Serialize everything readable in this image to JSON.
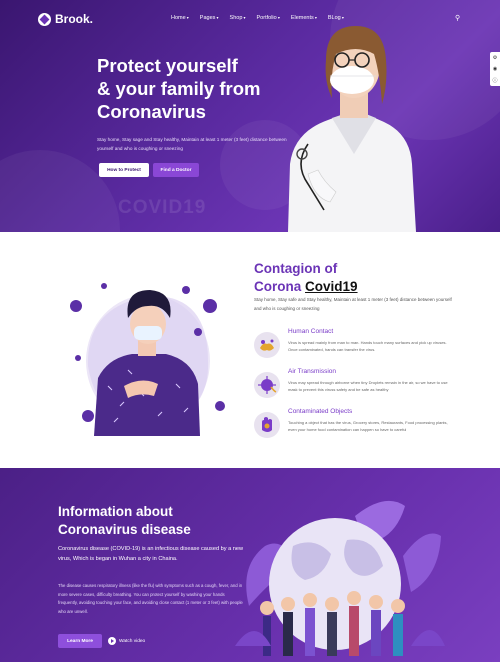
{
  "brand": {
    "name": "Brook."
  },
  "nav": {
    "items": [
      {
        "label": "Home"
      },
      {
        "label": "Pages"
      },
      {
        "label": "Shop"
      },
      {
        "label": "Portfolio"
      },
      {
        "label": "Elements"
      },
      {
        "label": "BLog"
      }
    ]
  },
  "hero": {
    "title_line1": "Protect yourself",
    "title_line2": "& your family from",
    "title_line3": "Coronavirus",
    "description": "Stay home, Stay sage and Stay healthy, Maintain at least 1 meter (3 feet) distance between yourself and who is coughing or sneezing",
    "primary_button": "How to Protect",
    "secondary_button": "Find a Doctor",
    "watermark": "COVID19"
  },
  "contagion": {
    "title_line1": "Contagion of",
    "title_part1": "Corona ",
    "title_highlight": "Covid19",
    "description": "Stay home, Stay safe and Stay healthy, Maintain at least 1 meter (3 feet) distance between yourself and who is coughing or sneezing",
    "features": [
      {
        "icon": "hands-icon",
        "title": "Human Contact",
        "text": "Virus is spread mainly from man to man. Hands touch many surfaces and pick up viruses. Once contaminated, hands can transfer the virus."
      },
      {
        "icon": "virus-icon",
        "title": "Air Transmission",
        "text": "Virus may spread through airborne when tiny Droplets remain in the air, so we have to use mask to prevent this viruss safety and be safe as healthy"
      },
      {
        "icon": "hand-icon",
        "title": "Contaminated Objects",
        "text": "Touching a object that has the virus, Grocery stores, Restaurants, Food processing plants, even your home food contamination can happen so have to careful"
      }
    ]
  },
  "info": {
    "title_line1": "Information about",
    "title_line2": "Coronavirus disease",
    "lead": "Coronavirus disease (COVID-19) is an infectious disease caused by a new virus, Which is began in Wuhan a city in Chaina.",
    "body": "The disease causes respiratory illness (like the flu) with symptoms such as a cough, fever, and in more severe cases, difficulty breathing. You can protect yourself by washing your hands frequently, avoiding touching your face, and avoiding close contact (1 meter or 3 feet) with people who are unwell.",
    "learn_button": "Learn More",
    "watch_label": "Watch video"
  },
  "colors": {
    "primary": "#6b34b6",
    "accent": "#8a47d6",
    "hero_dark": "#3a1670"
  }
}
